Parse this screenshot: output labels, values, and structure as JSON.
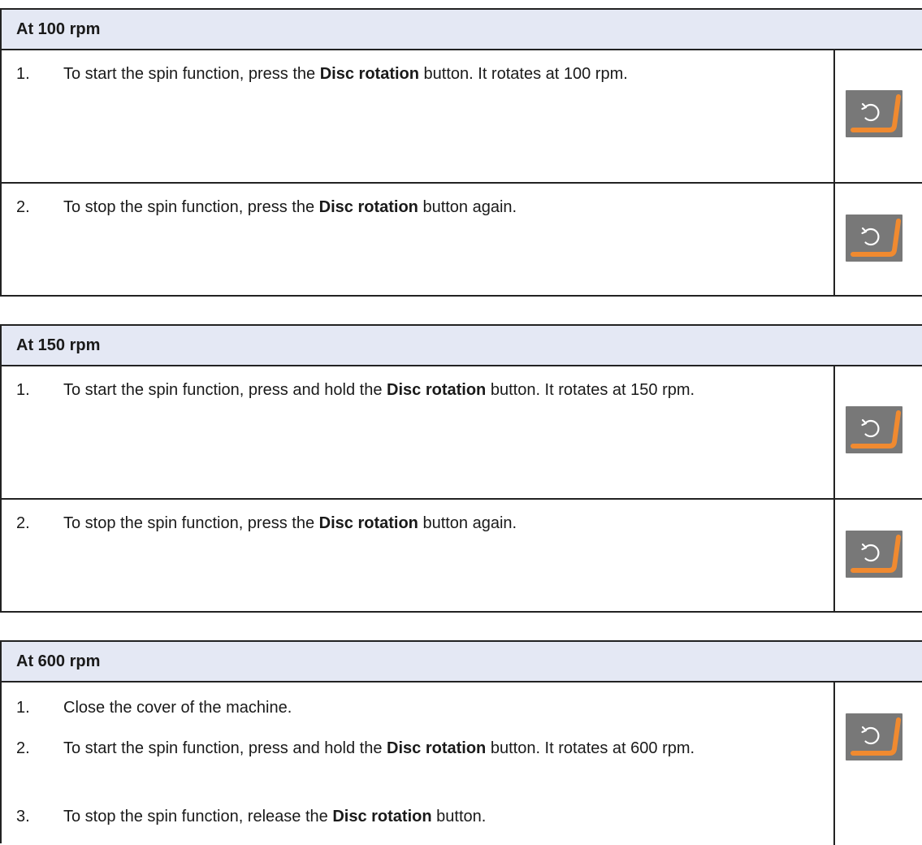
{
  "button_icon": "disc-rotation-icon",
  "colors": {
    "header_bg": "#e4e8f4",
    "button_bg": "#787878",
    "accent": "#f08a30"
  },
  "sections": [
    {
      "title": "At 100 rpm",
      "rows": [
        {
          "steps": [
            {
              "num": "1.",
              "pre": "To start the spin function, press the ",
              "bold": "Disc rotation",
              "post": " button. It rotates at 100 rpm."
            }
          ]
        },
        {
          "steps": [
            {
              "num": "2.",
              "pre": "To stop the spin function, press the ",
              "bold": "Disc rotation",
              "post": " button again."
            }
          ]
        }
      ]
    },
    {
      "title": "At 150 rpm",
      "rows": [
        {
          "steps": [
            {
              "num": "1.",
              "pre": "To start the spin function, press and hold the ",
              "bold": "Disc rotation",
              "post": " button. It rotates at 150 rpm."
            }
          ]
        },
        {
          "steps": [
            {
              "num": "2.",
              "pre": "To stop the spin function, press the ",
              "bold": "Disc rotation",
              "post": " button again."
            }
          ]
        }
      ]
    },
    {
      "title": "At 600 rpm",
      "rows": [
        {
          "steps": [
            {
              "num": "1.",
              "pre": "Close the cover of the machine.",
              "bold": "",
              "post": ""
            },
            {
              "num": "2.",
              "pre": "To start the spin function, press and hold the ",
              "bold": "Disc rotation",
              "post": " button. It rotates at 600 rpm."
            },
            {
              "num": "3.",
              "pre": "To stop the spin function, release the ",
              "bold": "Disc rotation",
              "post": " button."
            }
          ]
        }
      ]
    }
  ]
}
